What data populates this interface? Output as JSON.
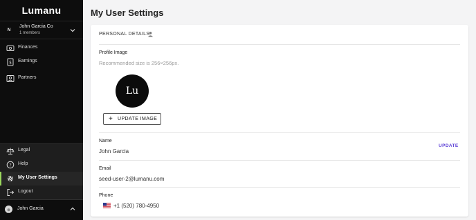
{
  "app": {
    "brand": "Lumanu"
  },
  "org": {
    "initials": "N",
    "name": "John Garcia Co",
    "members": "1 members"
  },
  "nav_top": [
    {
      "label": "Finances",
      "icon": "finances-icon"
    },
    {
      "label": "Earnings",
      "icon": "earnings-icon"
    },
    {
      "label": "Partners",
      "icon": "partners-icon"
    }
  ],
  "nav_bottom": [
    {
      "label": "Legal",
      "icon": "scale-icon"
    },
    {
      "label": "Help",
      "icon": "help-icon"
    },
    {
      "label": "My User Settings",
      "icon": "gear-icon",
      "active": true
    },
    {
      "label": "Logout",
      "icon": "logout-icon"
    }
  ],
  "user": {
    "name": "John Garcia"
  },
  "main": {
    "title": "My User Settings",
    "section_title": "PERSONAL DETAILS",
    "profile_image": {
      "label": "Profile Image",
      "hint": "Recommended size is 256×256px.",
      "avatar_text": "Lu",
      "button_label": "UPDATE IMAGE"
    },
    "name_field": {
      "label": "Name",
      "value": "John Garcia",
      "action": "UPDATE"
    },
    "email_field": {
      "label": "Email",
      "value": "seed-user-2@lumanu.com"
    },
    "phone_field": {
      "label": "Phone",
      "value": "+1 (520) 780-4950",
      "country": "us-flag-icon"
    }
  },
  "colors": {
    "sidebar_bg": "#0d0d0d",
    "active_indicator": "#9bd85c",
    "link": "#5b3fd6",
    "page_bg": "#f4f4f5"
  }
}
